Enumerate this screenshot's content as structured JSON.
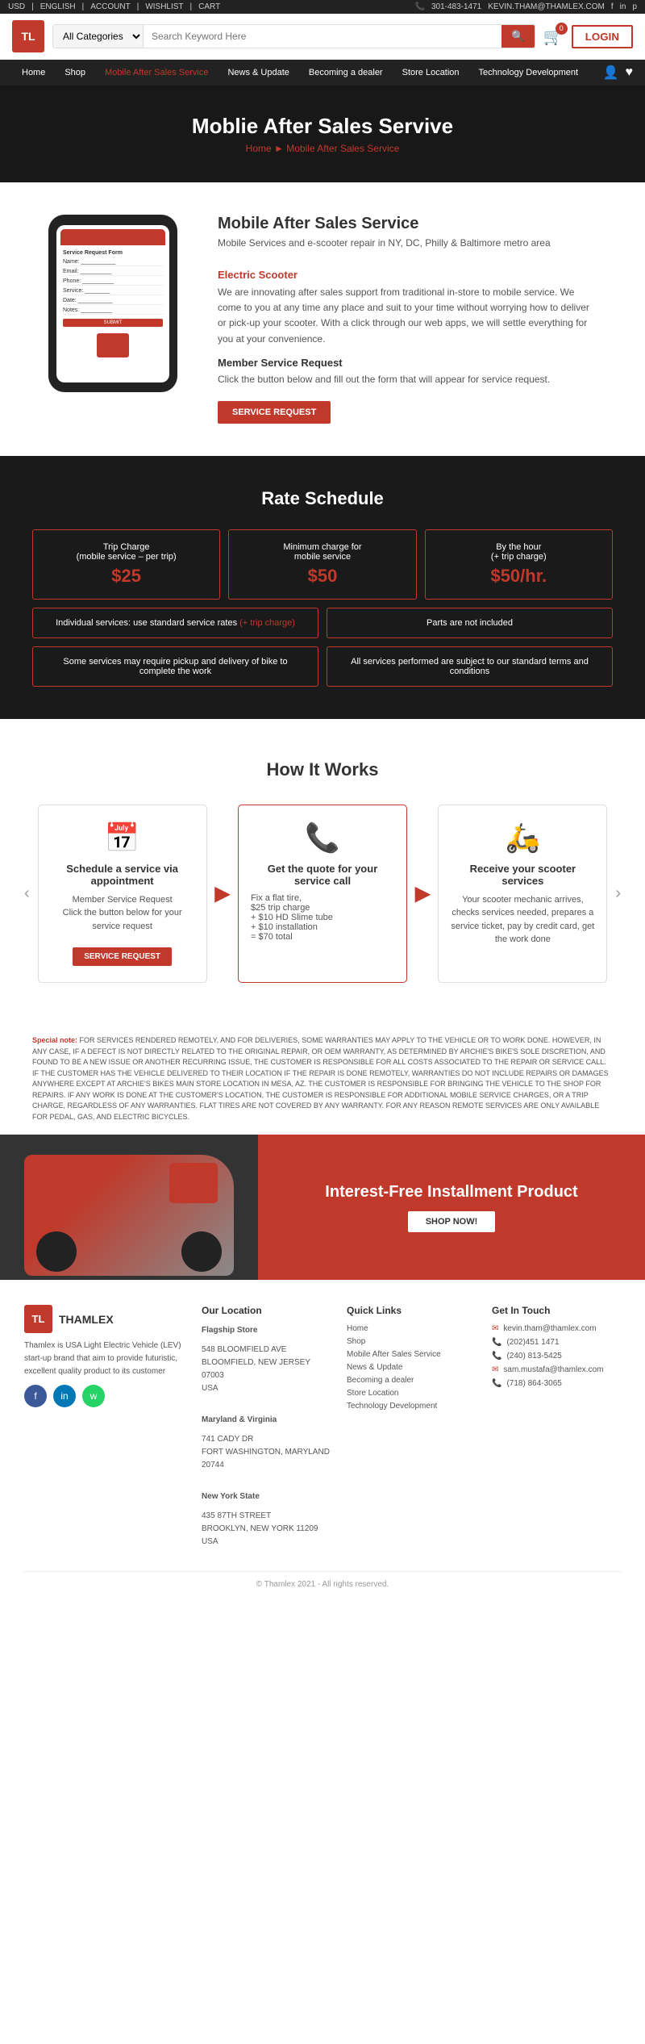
{
  "topBar": {
    "left": {
      "usd": "USD",
      "english": "ENGLISH",
      "account": "ACCOUNT",
      "wishlist": "WISHLIST",
      "cart": "CART"
    },
    "right": {
      "phone": "301-483-1471",
      "email": "KEVIN.THAM@THAMLEX.COM",
      "social": [
        "f",
        "in",
        "p"
      ]
    }
  },
  "header": {
    "logoText": "TL",
    "searchCategories": "All Categories",
    "searchPlaceholder": "Search Keyword Here",
    "searchIcon": "🔍",
    "cartIcon": "🛒",
    "cartCount": "0",
    "loginLabel": "LOGIN"
  },
  "nav": {
    "items": [
      {
        "label": "Home",
        "active": false
      },
      {
        "label": "Shop",
        "active": false
      },
      {
        "label": "Mobile After Sales Service",
        "active": true
      },
      {
        "label": "News & Update",
        "active": false
      },
      {
        "label": "Becoming a dealer",
        "active": false
      },
      {
        "label": "Store Location",
        "active": false
      },
      {
        "label": "Technology Development",
        "active": false
      }
    ]
  },
  "hero": {
    "title": "Moblie After Sales Servive",
    "breadcrumbHome": "Home",
    "breadcrumbArrow": "►",
    "breadcrumbCurrent": "Mobile After Sales Service"
  },
  "intro": {
    "title": "Mobile After Sales Service",
    "subtitle": "Mobile Services and e-scooter repair in NY, DC, Philly & Baltimore metro area",
    "redHeading": "Electric Scooter",
    "body": "We are innovating after sales support from traditional in-store to mobile service. We come to you at any time any place and suit to your time without worrying how to deliver or pick-up your scooter. With a click through our web apps, we will settle everything for you at your convenience.",
    "memberHeading": "Member Service Request",
    "memberDesc": "Click the button below and fill out the form that will appear for service request.",
    "buttonLabel": "SERVICE REQUEST"
  },
  "rateSchedule": {
    "title": "Rate Schedule",
    "cards": [
      {
        "label": "Trip Charge\n(mobile service – per trip)",
        "price": "$25"
      },
      {
        "label": "Minimum charge for\nmobile service",
        "price": "$50"
      },
      {
        "label": "By the hour\n(+ trip charge)",
        "price": "$50/hr."
      }
    ],
    "row2": [
      {
        "text": "Individual services: use standard service rates",
        "redText": "(+ trip charge)"
      },
      {
        "text": "Parts are not included"
      }
    ],
    "row3": [
      {
        "text": "Some services may require pickup and delivery of bike to complete the work"
      },
      {
        "text": "All services performed are subject to our standard terms and conditions"
      }
    ]
  },
  "howItWorks": {
    "title": "How It Works",
    "steps": [
      {
        "icon": "📅",
        "title": "Schedule a service via appointment",
        "desc": "Member Service Request\nClick the button below for your service request",
        "buttonLabel": "SERVICE REQUEST",
        "hasButton": true
      },
      {
        "icon": "📞",
        "title": "Get the quote for your service call",
        "desc": "",
        "priceList": [
          "Fix a flat tire,",
          "$25 trip charge",
          "+ $10 HD Slime tube",
          "+ $10 installation",
          "= $70 total"
        ],
        "hasButton": false
      },
      {
        "icon": "🛵",
        "title": "Receive your scooter services",
        "desc": "Your scooter mechanic arrives, checks services needed, prepares a service ticket, pay by credit card, get the work done",
        "hasButton": false
      }
    ]
  },
  "disclaimer": {
    "specialNote": "Special note:",
    "text": "FOR SERVICES RENDERED REMOTELY, AND FOR DELIVERIES, SOME WARRANTIES MAY APPLY TO THE VEHICLE OR TO WORK DONE. HOWEVER, IN ANY CASE, IF A DEFECT IS NOT DIRECTLY RELATED TO THE ORIGINAL REPAIR, OR OEM WARRANTY, AS DETERMINED BY ARCHIE'S BIKE'S SOLE DISCRETION, AND FOUND TO BE A NEW ISSUE OR ANOTHER RECURRING ISSUE, THE CUSTOMER IS RESPONSIBLE FOR ALL COSTS ASSOCIATED TO THE REPAIR OR SERVICE CALL. IF THE CUSTOMER HAS THE VEHICLE DELIVERED TO THEIR LOCATION IF THE REPAIR IS DONE REMOTELY, WARRANTIES DO NOT INCLUDE REPAIRS OR DAMAGES ANYWHERE EXCEPT AT ARCHIE'S BIKES MAIN STORE LOCATION IN MESA, AZ. THE CUSTOMER IS RESPONSIBLE FOR BRINGING THE VEHICLE TO THE SHOP FOR REPAIRS. IF ANY WORK IS DONE AT THE CUSTOMER'S LOCATION, THE CUSTOMER IS RESPONSIBLE FOR ADDITIONAL MOBILE SERVICE CHARGES, OR A TRIP CHARGE, REGARDLESS OF ANY WARRANTIES. FLAT TIRES ARE NOT COVERED BY ANY WARRANTY. FOR ANY REASON REMOTE SERVICES ARE ONLY AVAILABLE FOR PEDAL, GAS, AND ELECTRIC BICYCLES."
  },
  "installment": {
    "title": "Interest-Free Installment Product",
    "buttonLabel": "SHOP NOW!"
  },
  "footer": {
    "logoText": "TL",
    "brandName": "THAMLEX",
    "brandDesc": "Thamlex is USA Light Electric Vehicle (LEV) start-up brand that aim to provide futuristic, excellent quality product to its customer",
    "social": [
      "f",
      "in",
      "w"
    ],
    "locations": {
      "title": "Our Location",
      "flagship": {
        "name": "Flagship Store",
        "address1": "548 BLOOMFIELD AVE",
        "address2": "BLOOMFIELD, NEW JERSEY 07003",
        "address3": "USA"
      },
      "maryland": {
        "region": "Maryland & Virginia",
        "address1": "741 CADY DR",
        "address2": "FORT WASHINGTON, MARYLAND",
        "address3": "20744"
      },
      "newYork": {
        "region": "New York State",
        "address1": "435 87TH STREET",
        "address2": "BROOKLYN, NEW YORK 11209",
        "address3": "USA"
      }
    },
    "quickLinks": {
      "title": "Quick Links",
      "items": [
        "Home",
        "Shop",
        "Mobile After Sales Service",
        "News & Update",
        "Becoming a dealer",
        "Store Location",
        "Technology Development"
      ]
    },
    "contact": {
      "title": "Get In Touch",
      "items": [
        {
          "icon": "✉",
          "text": "kevin.tham@thamlex.com"
        },
        {
          "icon": "📞",
          "text": "(202)451 1471"
        },
        {
          "icon": "📞",
          "text": "(240) 813-5425"
        },
        {
          "icon": "✉",
          "text": "sam.mustafa@thamlex.com"
        },
        {
          "icon": "📞",
          "text": "(718) 864-3065"
        }
      ]
    },
    "copyright": "© Thamlex 2021 - All rights reserved."
  }
}
